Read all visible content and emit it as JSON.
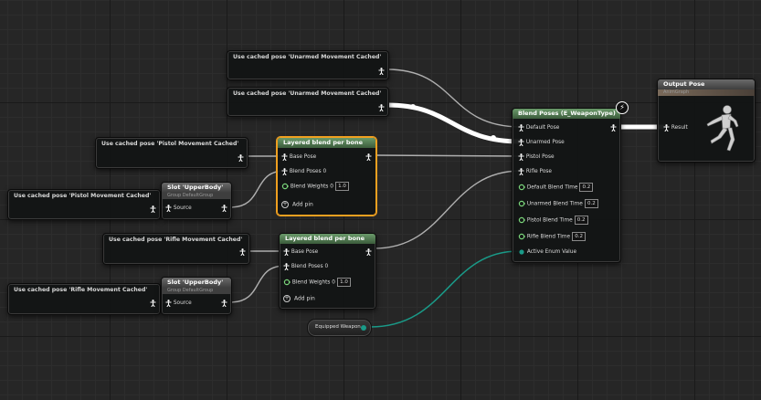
{
  "cached_nodes": [
    {
      "title": "Use cached pose 'Unarmed Movement Cached'"
    },
    {
      "title": "Use cached pose 'Unarmed Movement Cached'"
    },
    {
      "title": "Use cached pose 'Pistol Movement Cached'"
    },
    {
      "title": "Use cached pose 'Pistol Movement Cached'"
    },
    {
      "title": "Use cached pose 'Rifle Movement Cached'"
    },
    {
      "title": "Use cached pose 'Rifle Movement Cached'"
    }
  ],
  "slot_nodes": [
    {
      "title": "Slot 'UpperBody'",
      "subtitle": "Group DefaultGroup",
      "pin": "Source"
    },
    {
      "title": "Slot 'UpperBody'",
      "subtitle": "Group DefaultGroup",
      "pin": "Source"
    }
  ],
  "layered_nodes": [
    {
      "title": "Layered blend per bone",
      "base_pose": "Base Pose",
      "blend_poses": "Blend Poses 0",
      "blend_weights": "Blend Weights 0",
      "weight_value": "1.0",
      "add_pin": "Add pin"
    },
    {
      "title": "Layered blend per bone",
      "base_pose": "Base Pose",
      "blend_poses": "Blend Poses 0",
      "blend_weights": "Blend Weights 0",
      "weight_value": "1.0",
      "add_pin": "Add pin"
    }
  ],
  "blend_node": {
    "title": "Blend Poses (E_WeaponType)",
    "pins": [
      "Default Pose",
      "Unarmed Pose",
      "Pistol Pose",
      "Rifle Pose"
    ],
    "times": [
      {
        "label": "Default Blend Time",
        "value": "0.2"
      },
      {
        "label": "Unarmed Blend Time",
        "value": "0.2"
      },
      {
        "label": "Pistol Blend Time",
        "value": "0.2"
      },
      {
        "label": "Rifle Blend Time",
        "value": "0.2"
      }
    ],
    "active_enum": "Active Enum Value"
  },
  "output_node": {
    "title": "Output Pose",
    "subtitle": "AnimGraph",
    "pin": "Result"
  },
  "variable_node": {
    "label": "Equipped Weapon"
  },
  "colors": {
    "wire": "#c8c8c8",
    "enum_wire": "#1a9a88",
    "selected": "#f0a020",
    "node_title": "#4f7a4f"
  }
}
